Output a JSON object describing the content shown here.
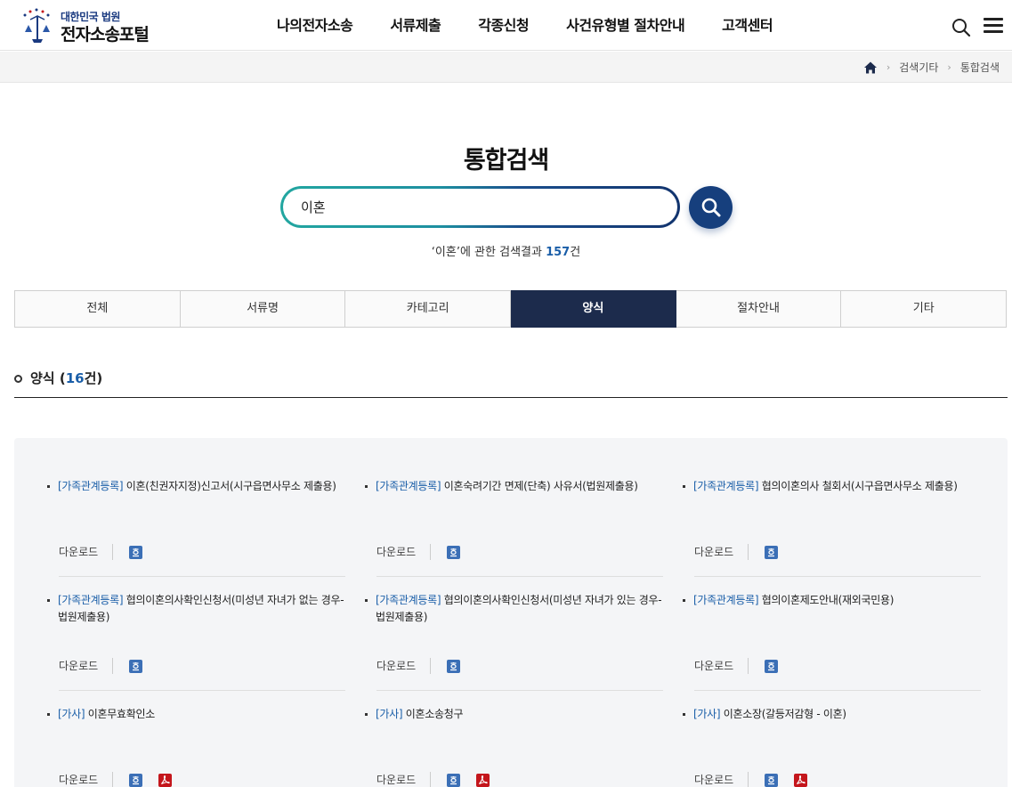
{
  "header": {
    "logo_top": "대한민국 법원",
    "logo_main": "전자소송포털",
    "nav": [
      "나의전자소송",
      "서류제출",
      "각종신청",
      "사건유형별 절차안내",
      "고객센터"
    ]
  },
  "breadcrumb": [
    "검색기타",
    "통합검색"
  ],
  "page_title": "통합검색",
  "search": {
    "value": "이혼",
    "placeholder": ""
  },
  "summary": {
    "prefix": "‘이혼’에 관한 검색결과 ",
    "count": "157",
    "suffix": "건"
  },
  "tabs": [
    {
      "label": "전체",
      "active": false
    },
    {
      "label": "서류명",
      "active": false
    },
    {
      "label": "카테고리",
      "active": false
    },
    {
      "label": "양식",
      "active": true
    },
    {
      "label": "절차안내",
      "active": false
    },
    {
      "label": "기타",
      "active": false
    }
  ],
  "section": {
    "label": "양식 (",
    "count": "16",
    "suffix": "건)"
  },
  "download_label": "다운로드",
  "results": [
    {
      "category": "[가족관계등록]",
      "title": "이혼(친권자지정)신고서(시구읍면사무소 제출용)",
      "files": [
        "hwp"
      ]
    },
    {
      "category": "[가족관계등록]",
      "title": "이혼숙려기간 면제(단축) 사유서(법원제출용)",
      "files": [
        "hwp"
      ]
    },
    {
      "category": "[가족관계등록]",
      "title": "협의이혼의사 철회서(시구읍면사무소 제출용)",
      "files": [
        "hwp"
      ]
    },
    {
      "category": "[가족관계등록]",
      "title": "협의이혼의사확인신청서(미성년 자녀가 없는 경우-법원제출용)",
      "files": [
        "hwp"
      ]
    },
    {
      "category": "[가족관계등록]",
      "title": "협의이혼의사확인신청서(미성년 자녀가 있는 경우-법원제출용)",
      "files": [
        "hwp"
      ]
    },
    {
      "category": "[가족관계등록]",
      "title": "협의이혼제도안내(재외국민용)",
      "files": [
        "hwp"
      ]
    },
    {
      "category": "[가사]",
      "title": "이혼무효확인소",
      "files": [
        "hwp",
        "pdf"
      ]
    },
    {
      "category": "[가사]",
      "title": "이혼소송청구",
      "files": [
        "hwp",
        "pdf"
      ]
    },
    {
      "category": "[가사]",
      "title": "이혼소장(갈등저감형 - 이혼)",
      "files": [
        "hwp",
        "pdf"
      ]
    }
  ],
  "colors": {
    "accent": "#1a5ea8",
    "tab_active": "#1c2b4c",
    "search_button": "#163f7d",
    "hwp_icon": "#3b6fb6",
    "pdf_icon": "#c4161c"
  },
  "icons": {
    "search": "search-icon",
    "menu": "hamburger-menu-icon",
    "home": "home-icon",
    "hwp": "hwp-file-icon",
    "pdf": "pdf-file-icon"
  }
}
